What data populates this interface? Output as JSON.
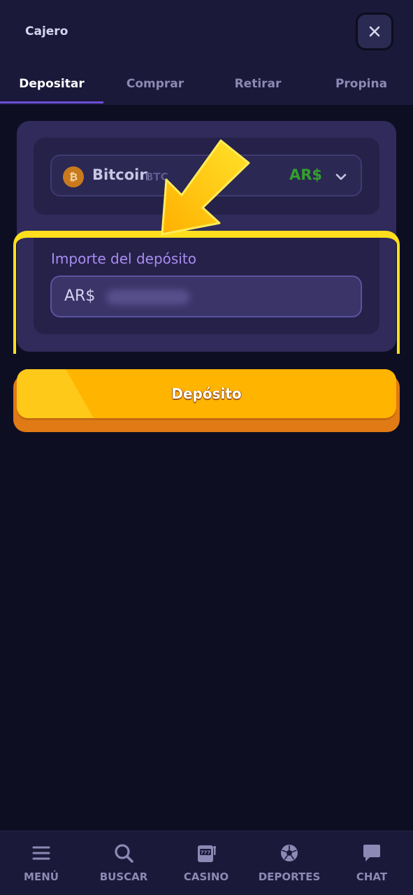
{
  "header": {
    "title": "Cajero",
    "close_icon": "close-icon"
  },
  "tabs": [
    {
      "label": "Depositar",
      "active": true
    },
    {
      "label": "Comprar",
      "active": false
    },
    {
      "label": "Retirar",
      "active": false
    },
    {
      "label": "Propina",
      "active": false
    }
  ],
  "currency_select": {
    "coin_name": "Bitcoin",
    "coin_ticker": "BTC",
    "fiat_code": "AR$",
    "coin_icon": "bitcoin-icon"
  },
  "deposit": {
    "amount_label": "Importe del depósito",
    "amount_prefix": "AR$",
    "button_label": "Depósito"
  },
  "bottom_nav": [
    {
      "label": "MENÚ",
      "icon": "menu-icon"
    },
    {
      "label": "BUSCAR",
      "icon": "search-icon"
    },
    {
      "label": "CASINO",
      "icon": "slot-machine-icon"
    },
    {
      "label": "DEPORTES",
      "icon": "soccer-ball-icon"
    },
    {
      "label": "CHAT",
      "icon": "chat-bubble-icon"
    }
  ],
  "colors": {
    "accent": "#6b4fd6",
    "button": "#ffb400",
    "fiat_green": "#33a02c",
    "highlight": "#ffdf1d"
  }
}
